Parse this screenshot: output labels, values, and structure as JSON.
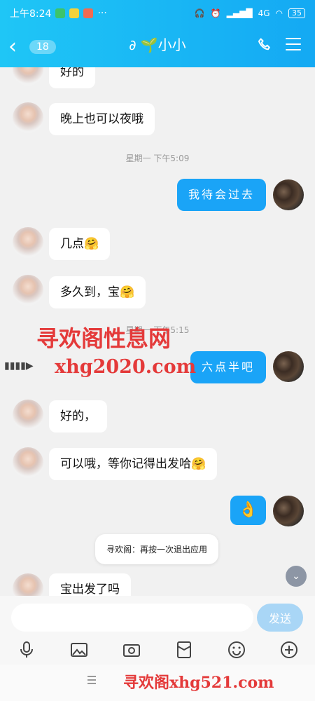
{
  "status_bar": {
    "time": "上午8:24",
    "dots": "···",
    "network": "4G",
    "battery": "35"
  },
  "nav": {
    "unread_count": "18",
    "contact_name": "小小"
  },
  "messages": {
    "m1": "好的",
    "m2": "晚上也可以夜哦",
    "time1": "星期一 下午5:09",
    "m3": "我待会过去",
    "m4": "几点🤗",
    "m5": "多久到，宝🤗",
    "time2": "星期一 下午5:15",
    "m6": "六点半吧",
    "m7": "好的，",
    "m8": "可以哦，等你记得出发哈🤗",
    "m9": "👌",
    "m10": "宝出发了吗"
  },
  "toast": "寻欢阁：再按一次退出应用",
  "input": {
    "placeholder": "",
    "send_label": "发送"
  },
  "watermarks": {
    "line1": "寻欢阁性息网",
    "line2": "xhg2020.com",
    "bottom": "寻欢阁xhg521.com"
  },
  "icons": {
    "back": "chevron-left-icon",
    "phone": "phone-icon",
    "menu": "menu-icon",
    "mic": "microphone-icon",
    "image": "image-icon",
    "camera": "camera-icon",
    "red_packet": "red-packet-icon",
    "emoji": "emoji-icon",
    "plus": "plus-icon"
  }
}
